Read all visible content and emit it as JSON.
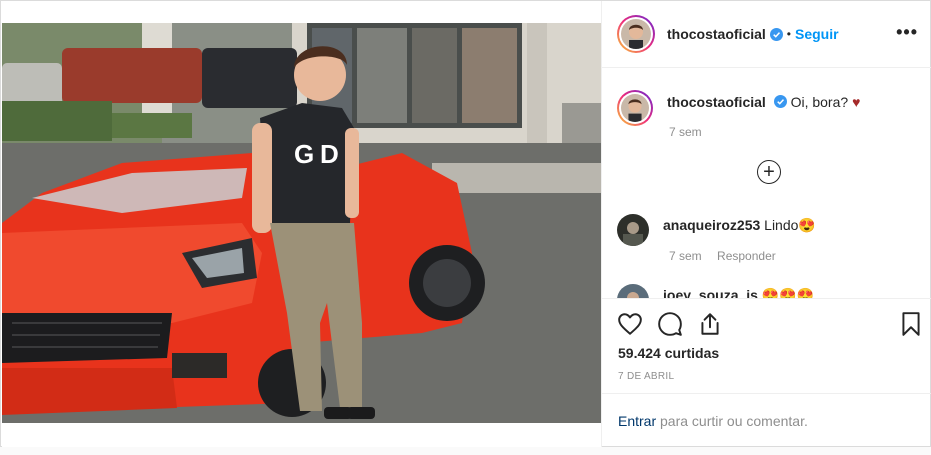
{
  "post": {
    "author": "thocostaoficial",
    "follow_label": "Seguir",
    "separator": "•",
    "more_label": "•••"
  },
  "caption": {
    "username": "thocostaoficial",
    "text": "Oi, bora?",
    "time": "7 sem"
  },
  "comments": [
    {
      "username": "anaqueiroz253",
      "text": "Lindo😍",
      "time": "7 sem",
      "reply_label": "Responder"
    },
    {
      "username": "joey_souza_js",
      "text": "😍😍😍"
    }
  ],
  "load_more_icon": "plus-circle-icon",
  "stats": {
    "likes": "59.424 curtidas",
    "date": "7 DE ABRIL"
  },
  "login": {
    "link_label": "Entrar",
    "rest_text": "para curtir ou comentar."
  },
  "colors": {
    "link_blue": "#0095f6",
    "car_red": "#e8331c",
    "heart": "#a52a2a"
  }
}
